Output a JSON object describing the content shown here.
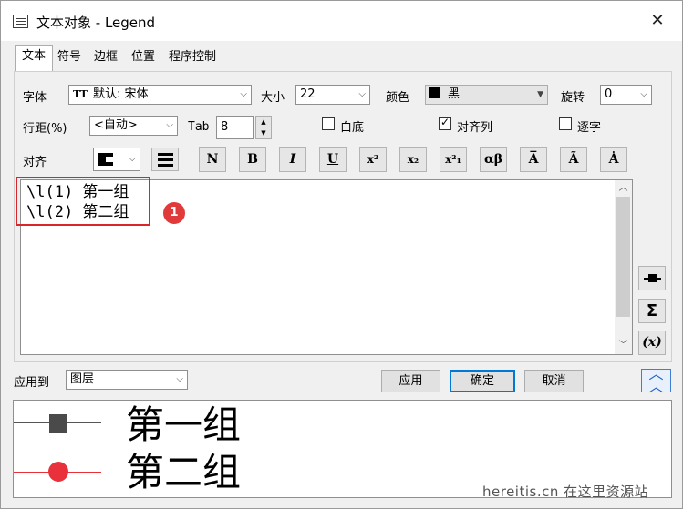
{
  "window": {
    "title": "文本对象 - Legend",
    "close": "✕"
  },
  "tabs": [
    "文本",
    "符号",
    "边框",
    "位置",
    "程序控制"
  ],
  "font": {
    "label": "字体",
    "value": "默认: 宋体",
    "icon": "TT"
  },
  "size": {
    "label": "大小",
    "value": "22"
  },
  "color": {
    "label": "颜色",
    "value": "黑",
    "swatch": "#000000"
  },
  "rotate": {
    "label": "旋转",
    "value": "0"
  },
  "line_spacing": {
    "label": "行距(%)",
    "value": "<自动>"
  },
  "tab_width": {
    "label": "Tab",
    "value": "8"
  },
  "checks": {
    "white_bg": {
      "label": "白底",
      "checked": false
    },
    "align_columns": {
      "label": "对齐列",
      "checked": true
    },
    "char_by_char": {
      "label": "逐字",
      "checked": false
    }
  },
  "align": {
    "label": "对齐"
  },
  "format_buttons": [
    "N",
    "B",
    "I",
    "U",
    "x²",
    "x₂",
    "x²₁",
    "αβ",
    "A̅",
    "Ã",
    "Ȧ"
  ],
  "editor": {
    "lines": [
      "\\l(1) 第一组",
      "\\l(2) 第二组"
    ]
  },
  "annotation": {
    "marker": "1"
  },
  "side_buttons": [
    "Σ",
    "(x)"
  ],
  "apply_to": {
    "label": "应用到",
    "value": "图层"
  },
  "buttons": {
    "apply": "应用",
    "ok": "确定",
    "cancel": "取消"
  },
  "preview": {
    "items": [
      {
        "label": "第一组",
        "symbol": "square",
        "color": "#4a4a4a"
      },
      {
        "label": "第二组",
        "symbol": "circle",
        "color": "#e8313a"
      }
    ]
  },
  "watermark": "hereitis.cn 在这里资源站"
}
